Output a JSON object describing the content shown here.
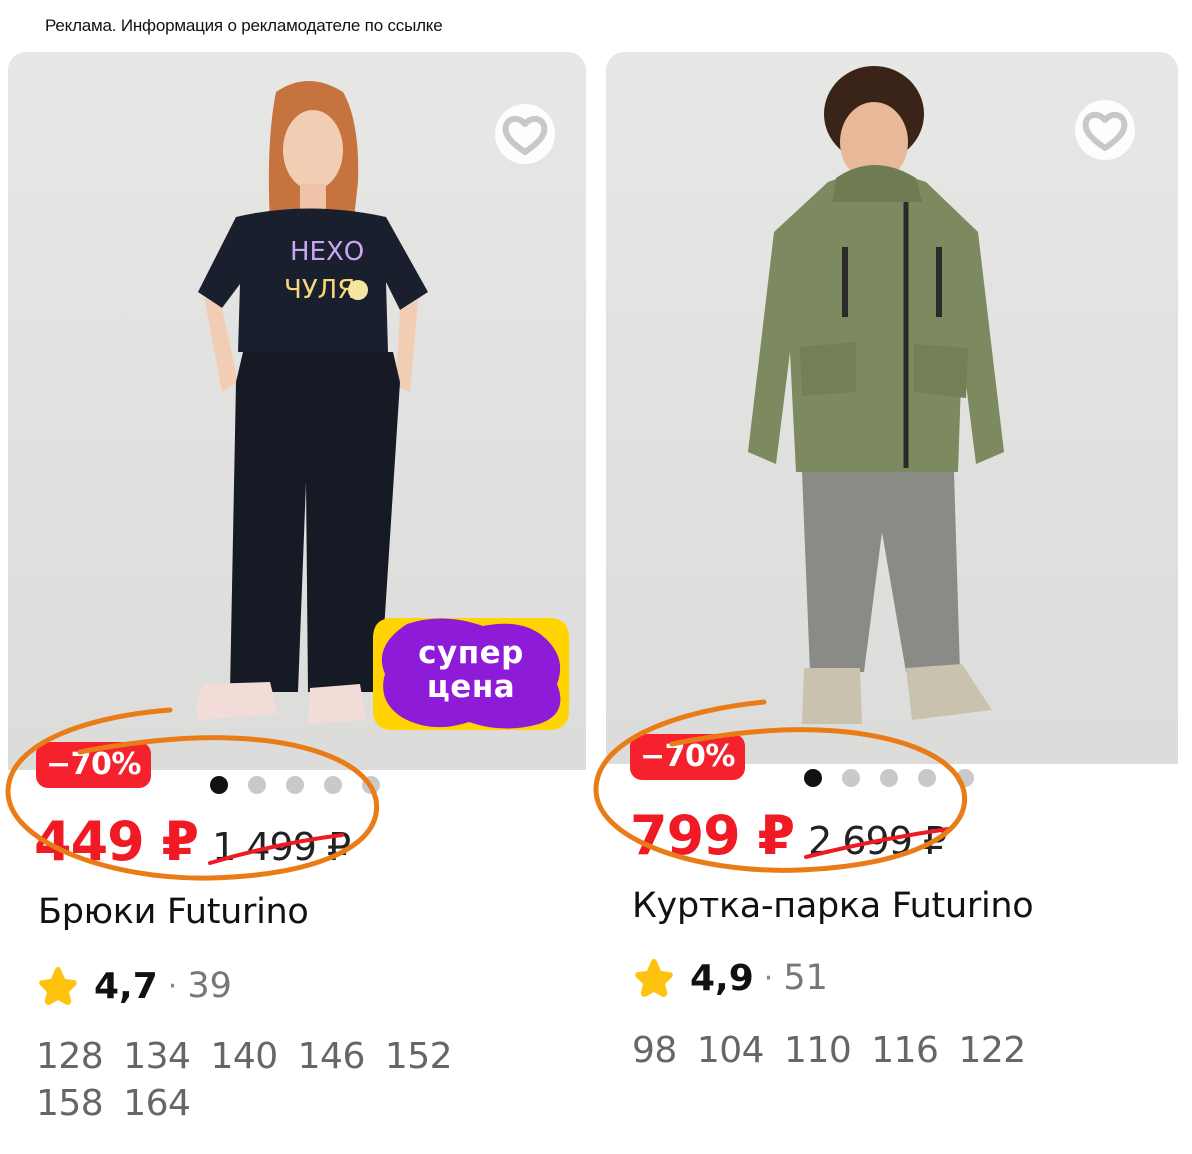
{
  "ad_note": "Реклама. Информация о рекламодателе по ссылке",
  "colors": {
    "accent_red": "#f01a24",
    "circle_orange": "#ea7c17",
    "star_yellow": "#ffc20e",
    "super_purple": "#8e1bd8",
    "super_yellow": "#ffd400"
  },
  "cards": [
    {
      "heart_icon": "heart-outline-icon",
      "super_badge": {
        "line1": "супер",
        "line2": "цена"
      },
      "discount": "−70%",
      "dots_total": 5,
      "dots_active": 0,
      "price_now": "449 ₽",
      "price_old": "1 499 ₽",
      "title": "Брюки Futurino",
      "rating": "4,7",
      "rating_sep": "·",
      "reviews": "39",
      "sizes": [
        "128",
        "134",
        "140",
        "146",
        "152",
        "158",
        "164"
      ]
    },
    {
      "heart_icon": "heart-outline-icon",
      "discount": "−70%",
      "dots_total": 5,
      "dots_active": 0,
      "price_now": "799 ₽",
      "price_old": "2 699 ₽",
      "title": "Куртка-парка Futurino",
      "rating": "4,9",
      "rating_sep": "·",
      "reviews": "51",
      "sizes": [
        "98",
        "104",
        "110",
        "116",
        "122"
      ]
    }
  ]
}
